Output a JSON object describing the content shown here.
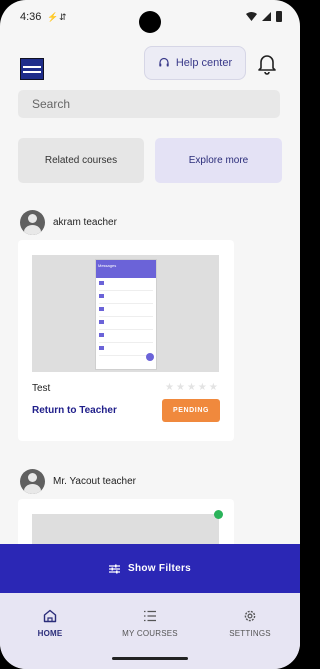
{
  "status": {
    "time": "4:36"
  },
  "header": {
    "help_label": "Help center"
  },
  "search": {
    "placeholder": "Search"
  },
  "tiles": {
    "related": "Related courses",
    "explore": "Explore more"
  },
  "posts": [
    {
      "author": "akram teacher",
      "title": "Test",
      "action": "Return to Teacher",
      "status": "PENDING",
      "rating": 0,
      "rating_max": 5,
      "thumb_header": "Messages"
    },
    {
      "author": "Mr. Yacout teacher"
    }
  ],
  "filters": {
    "label": "Show Filters"
  },
  "nav": {
    "home": "HOME",
    "courses": "MY COURSES",
    "settings": "SETTINGS"
  },
  "colors": {
    "primary": "#2b27b5",
    "pending": "#f0893d",
    "accent_text": "#1f1e8a",
    "online": "#2ab35a"
  }
}
